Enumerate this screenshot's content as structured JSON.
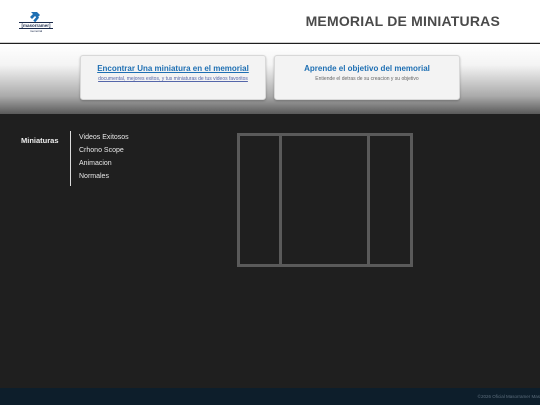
{
  "header": {
    "logo_text": "[masorramer]",
    "logo_subtext": "memorial",
    "title": "MEMORIAL DE MINIATURAS"
  },
  "banner": {
    "cards": [
      {
        "title": "Encontrar Una miniatura en el memorial",
        "description": "documental, mejores exitos, y tus miniaturas de tus videos favoritos"
      },
      {
        "title": "Aprende el objetivo del memorial",
        "description": "Entiende el detras de su creacion y su objetivo"
      }
    ]
  },
  "sidebar": {
    "heading": "Miniaturas",
    "items": [
      {
        "label": "Videos Exitosos"
      },
      {
        "label": "Crhono Scope"
      },
      {
        "label": "Animacion"
      },
      {
        "label": "Normales"
      }
    ]
  },
  "footer": {
    "text": "©2026 Oficial Masorramer Mas"
  },
  "colors": {
    "accent": "#1e6fb3",
    "background": "#1f1f1f",
    "footer": "#0d1e2b"
  },
  "icons": {
    "logo": "hammer-logo-icon"
  }
}
